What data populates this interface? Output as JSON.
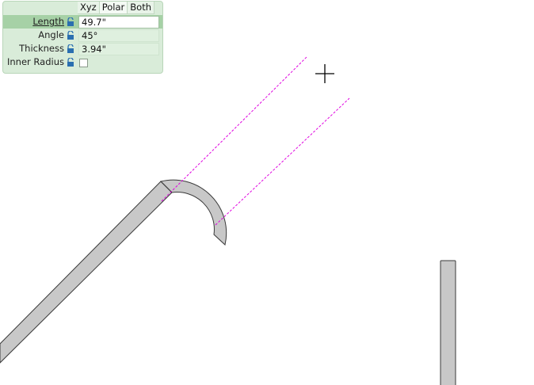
{
  "panel": {
    "tabs": [
      {
        "label": "Xyz"
      },
      {
        "label": "Polar"
      },
      {
        "label": "Both"
      }
    ],
    "rows": [
      {
        "label": "Length",
        "value": "49.7\"",
        "editing": true
      },
      {
        "label": "Angle",
        "value": "45°"
      },
      {
        "label": "Thickness",
        "value": "3.94\""
      },
      {
        "label": "Inner Radius",
        "checkbox": false
      }
    ]
  },
  "colors": {
    "panel_bg": "#d9ecd9",
    "highlight_row": "#a6d1a6",
    "wall_fill": "#c8c8c8",
    "guide_line": "#e000e0",
    "lock_icon": "#2a6fb0"
  },
  "icons": [
    "lock-icon",
    "crosshair-cursor-icon"
  ]
}
